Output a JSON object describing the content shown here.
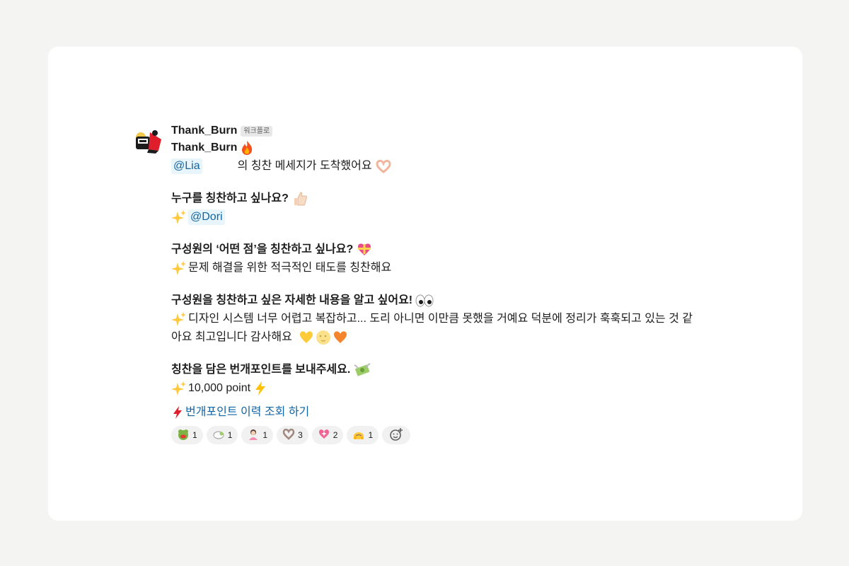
{
  "message": {
    "sender": "Thank_Burn",
    "app_badge": "워크플로",
    "title": "Thank_Burn",
    "recipient_mention": "@Lia",
    "intro_text": "의 칭찬 메세지가 도착했어요",
    "q1": "누구를 칭찬하고 싶나요?",
    "a1_mention": "@Dori",
    "q2": "구성원의 ‘어떤 점’을 칭찬하고 싶나요?",
    "a2": "문제 해결을 위한 적극적인 태도를 칭찬해요",
    "q3": "구성원을 칭찬하고 싶은 자세한 내용을 알고 싶어요!",
    "a3": "디자인 시스템 너무 어렵고 복잡하고... 도리 아니면 이만큼 못했을 거예요 덕분에 정리가 훅훅되고 있는 것 같아요 최고입니다 감사해요",
    "q4": "칭찬을 담은 번개포인트를 보내주세요.",
    "a4": "10,000 point",
    "history_link": "번개포인트 이력 조회 하기"
  },
  "reactions": [
    {
      "icon": "frog-icon",
      "count": "1"
    },
    {
      "icon": "lamb-icon",
      "count": "1"
    },
    {
      "icon": "person-bowing-icon",
      "count": "1"
    },
    {
      "icon": "heart-hands-icon",
      "count": "3"
    },
    {
      "icon": "sparkling-heart-icon",
      "count": "2"
    },
    {
      "icon": "bowing-face-icon",
      "count": "1"
    }
  ],
  "colors": {
    "background": "#f4f4f2",
    "card": "#ffffff",
    "link": "#1264a3",
    "mention_bg": "#e8f5fa",
    "reaction_bg": "#f1f1f1"
  }
}
